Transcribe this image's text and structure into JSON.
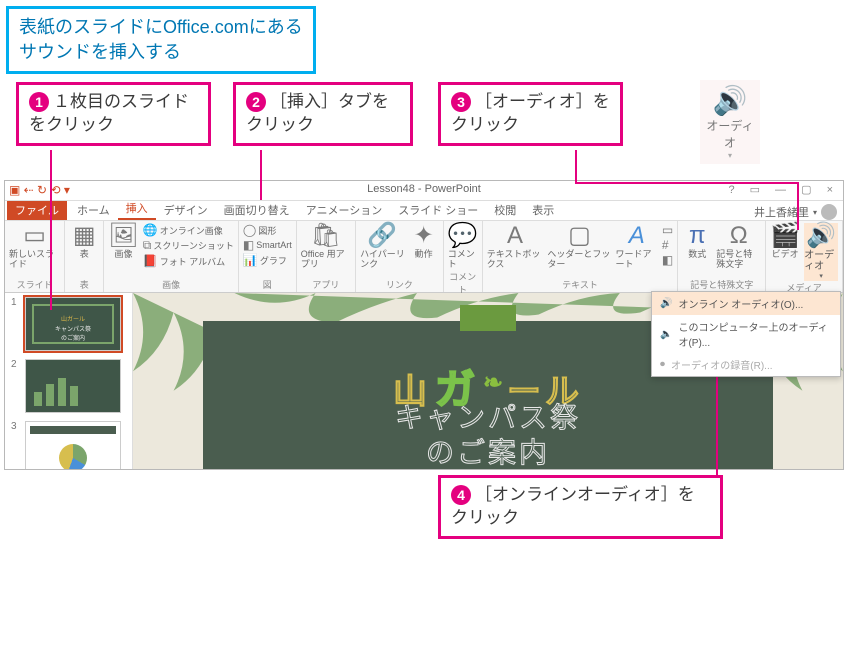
{
  "instruction": {
    "title_line1": "表紙のスライドにOffice.comにある",
    "title_line2": "サウンドを挿入する"
  },
  "callouts": {
    "c1": {
      "num": "1",
      "text": "１枚目のスライドをクリック"
    },
    "c2": {
      "num": "2",
      "text": "［挿入］タブをクリック"
    },
    "c3": {
      "num": "3",
      "text": "［オーディオ］をクリック"
    },
    "c4": {
      "num": "4",
      "text": "［オンラインオーディオ］をクリック"
    }
  },
  "audio_sample_label": "オーディオ",
  "window": {
    "title": "Lesson48 - PowerPoint",
    "user": "井上香緒里",
    "tabs": {
      "file": "ファイル",
      "home": "ホーム",
      "insert": "挿入",
      "design": "デザイン",
      "transitions": "画面切り替え",
      "animations": "アニメーション",
      "slideshow": "スライド ショー",
      "review": "校閲",
      "view": "表示"
    },
    "ribbon": {
      "slides": {
        "new_slide": "新しいスライド",
        "label": "スライド"
      },
      "tables": {
        "table": "表",
        "label": "表"
      },
      "images": {
        "picture": "画像",
        "online_images": "オンライン画像",
        "screenshot": "スクリーンショット",
        "photo_album": "フォト アルバム",
        "label": "画像"
      },
      "illust": {
        "shapes": "図形",
        "smartart": "SmartArt",
        "chart": "グラフ",
        "label": "図"
      },
      "apps": {
        "office_apps": "Office 用アプリ",
        "label": "アプリ"
      },
      "links": {
        "hyperlink": "ハイパーリンク",
        "action": "動作",
        "label": "リンク"
      },
      "comments": {
        "comment": "コメント",
        "label": "コメント"
      },
      "text": {
        "textbox": "テキストボックス",
        "header_footer": "ヘッダーとフッター",
        "wordart": "ワードアート",
        "label": "テキスト"
      },
      "symbols": {
        "equation": "数式",
        "symbol": "記号と特殊文字",
        "label": "記号と特殊文字"
      },
      "media": {
        "video": "ビデオ",
        "audio": "オーディオ",
        "label": "メディア"
      }
    },
    "audio_menu": {
      "online": "オンライン オーディオ(O)...",
      "from_pc": "このコンピューター上のオーディオ(P)...",
      "record": "オーディオの録音(R)..."
    }
  },
  "slide": {
    "title_p1": "山",
    "title_p2": "ガ",
    "title_p3": "ール",
    "subtitle_line1": "キャンパス祭",
    "subtitle_line2": "のご案内"
  },
  "colors": {
    "accent_pink": "#e4007f",
    "accent_blue": "#00aeef",
    "pp_orange": "#d04a25",
    "slide_bg": "#4a5d4f",
    "leaf": "#7ba56b"
  }
}
